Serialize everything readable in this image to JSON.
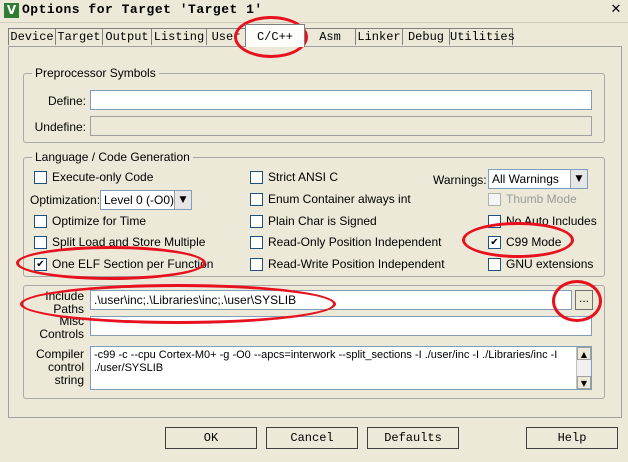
{
  "window": {
    "title": "Options for Target 'Target 1'",
    "close_glyph": "✕",
    "icon_glyph": "V"
  },
  "tabs": [
    "Device",
    "Target",
    "Output",
    "Listing",
    "User",
    "C/C++",
    "Asm",
    "Linker",
    "Debug",
    "Utilities"
  ],
  "active_tab": "C/C++",
  "preprocessor": {
    "title": "Preprocessor Symbols",
    "define_label": "Define:",
    "define_value": "",
    "undefine_label": "Undefine:",
    "undefine_value": ""
  },
  "language": {
    "title": "Language / Code Generation",
    "execute_only": {
      "label": "Execute-only Code",
      "checked": false
    },
    "optimization_label": "Optimization:",
    "optimization_value": "Level 0 (-O0)",
    "optimize_time": {
      "label": "Optimize for Time",
      "checked": false
    },
    "split_load": {
      "label": "Split Load and Store Multiple",
      "checked": false
    },
    "one_elf": {
      "label": "One ELF Section per Function",
      "checked": true
    },
    "strict_ansi": {
      "label": "Strict ANSI C",
      "checked": false
    },
    "enum_container": {
      "label": "Enum Container always int",
      "checked": false
    },
    "plain_char": {
      "label": "Plain Char is Signed",
      "checked": false
    },
    "ro_pos": {
      "label": "Read-Only Position Independent",
      "checked": false
    },
    "rw_pos": {
      "label": "Read-Write Position Independent",
      "checked": false
    },
    "warnings_label": "Warnings:",
    "warnings_value": "All Warnings",
    "thumb_mode": {
      "label": "Thumb Mode",
      "checked": false,
      "disabled": true
    },
    "no_auto_includes": {
      "label": "No Auto Includes",
      "checked": false
    },
    "c99_mode": {
      "label": "C99 Mode",
      "checked": true
    },
    "gnu_ext": {
      "label": "GNU extensions",
      "checked": false
    }
  },
  "include_paths": {
    "label": "Include Paths",
    "value": ".\\user\\inc;.\\Libraries\\inc;.\\user\\SYSLIB",
    "browse": "..."
  },
  "misc_controls": {
    "label": "Misc Controls",
    "value": ""
  },
  "compiler_control": {
    "label": "Compiler control string",
    "value": "-c99 -c --cpu Cortex-M0+ -g -O0 --apcs=interwork --split_sections -I ./user/inc -I ./Libraries/inc -I ./user/SYSLIB"
  },
  "buttons": {
    "ok": "OK",
    "cancel": "Cancel",
    "defaults": "Defaults",
    "help": "Help"
  },
  "annotation_color": "#e8111e",
  "check_glyph": "✔"
}
